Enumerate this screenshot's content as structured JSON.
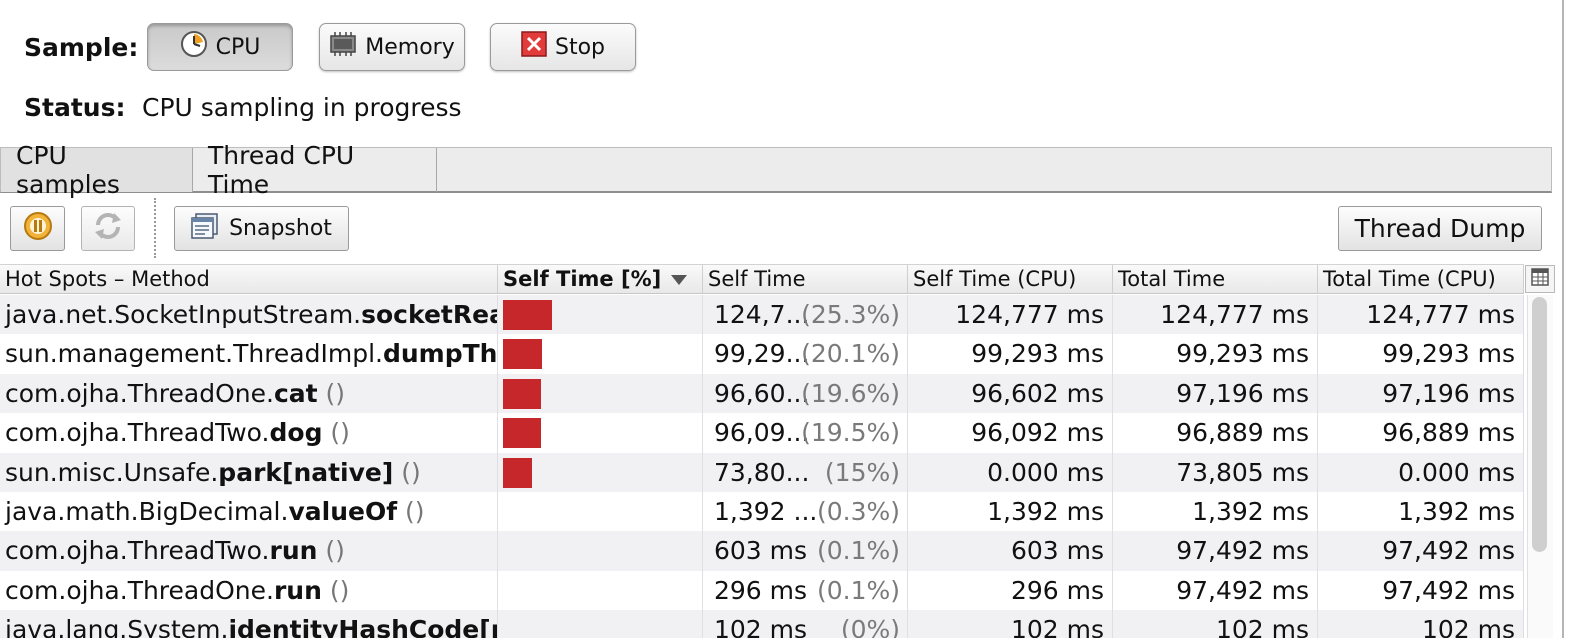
{
  "sample": {
    "label": "Sample:",
    "buttons": [
      {
        "label": "CPU",
        "icon": "clock-icon",
        "pressed": true
      },
      {
        "label": "Memory",
        "icon": "memory-chip-icon",
        "pressed": false
      },
      {
        "label": "Stop",
        "icon": "stop-x-icon",
        "pressed": false
      }
    ]
  },
  "status": {
    "label": "Status:",
    "text": "CPU sampling in progress"
  },
  "tabs": [
    {
      "label": "CPU samples",
      "active": true
    },
    {
      "label": "Thread CPU Time",
      "active": false
    }
  ],
  "toolbar": {
    "pause_icon": "pause-icon",
    "refresh_icon": "refresh-icon",
    "snapshot_label": "Snapshot",
    "thread_dump_label": "Thread Dump"
  },
  "table": {
    "columns": [
      "Hot Spots – Method",
      "Self Time [%]",
      "Self Time",
      "Self Time (CPU)",
      "Total Time",
      "Total Time (CPU)"
    ],
    "sorted_column": "Self Time [%]",
    "bar_color": "#c5272b",
    "rows": [
      {
        "pkg": "java.net.SocketInputStream.",
        "name": "socketRead",
        "args": "",
        "percent": 25.3,
        "self_time": "124,7...",
        "self_pct": "(25.3%)",
        "self_cpu": "124,777 ms",
        "total": "124,777 ms",
        "total_cpu": "124,777 ms"
      },
      {
        "pkg": "sun.management.ThreadImpl.",
        "name": "dumpThreads",
        "args": "",
        "percent": 20.1,
        "self_time": "99,29...",
        "self_pct": "(20.1%)",
        "self_cpu": "99,293 ms",
        "total": "99,293 ms",
        "total_cpu": "99,293 ms"
      },
      {
        "pkg": "com.ojha.ThreadOne.",
        "name": "cat",
        "args": " ()",
        "percent": 19.6,
        "self_time": "96,60...",
        "self_pct": "(19.6%)",
        "self_cpu": "96,602 ms",
        "total": "97,196 ms",
        "total_cpu": "97,196 ms"
      },
      {
        "pkg": "com.ojha.ThreadTwo.",
        "name": "dog",
        "args": " ()",
        "percent": 19.5,
        "self_time": "96,09...",
        "self_pct": "(19.5%)",
        "self_cpu": "96,092 ms",
        "total": "96,889 ms",
        "total_cpu": "96,889 ms"
      },
      {
        "pkg": "sun.misc.Unsafe.",
        "name": "park[native]",
        "args": " ()",
        "percent": 15,
        "self_time": "73,80...",
        "self_pct": "(15%)",
        "self_cpu": "0.000 ms",
        "total": "73,805 ms",
        "total_cpu": "0.000 ms"
      },
      {
        "pkg": "java.math.BigDecimal.",
        "name": "valueOf",
        "args": " ()",
        "percent": 0.3,
        "self_time": "1,392 ...",
        "self_pct": "(0.3%)",
        "self_cpu": "1,392 ms",
        "total": "1,392 ms",
        "total_cpu": "1,392 ms"
      },
      {
        "pkg": "com.ojha.ThreadTwo.",
        "name": "run",
        "args": " ()",
        "percent": 0.1,
        "self_time": "603 ms",
        "self_pct": "(0.1%)",
        "self_cpu": "603 ms",
        "total": "97,492 ms",
        "total_cpu": "97,492 ms"
      },
      {
        "pkg": "com.ojha.ThreadOne.",
        "name": "run",
        "args": " ()",
        "percent": 0.1,
        "self_time": "296 ms",
        "self_pct": "(0.1%)",
        "self_cpu": "296 ms",
        "total": "97,492 ms",
        "total_cpu": "97,492 ms"
      },
      {
        "pkg": "java.lang.System.",
        "name": "identityHashCode[native]",
        "args": "",
        "percent": 0,
        "self_time": "102 ms",
        "self_pct": "(0%)",
        "self_cpu": "102 ms",
        "total": "102 ms",
        "total_cpu": "102 ms"
      }
    ]
  }
}
